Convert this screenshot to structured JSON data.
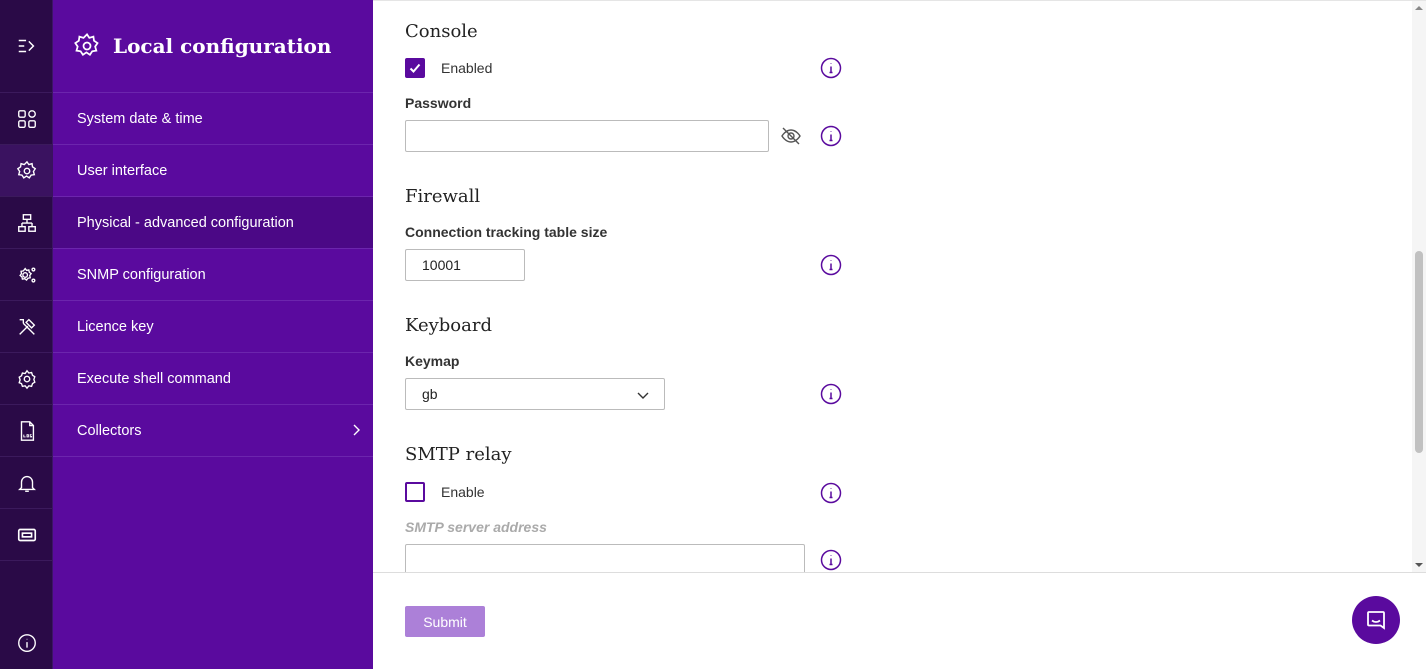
{
  "colors": {
    "accent": "#5a0a9e",
    "rail": "#2a0a47",
    "submit_disabled": "#ac80d8"
  },
  "rail": {
    "icons": [
      "menu-toggle-icon",
      "dashboard-icon",
      "config-gear-icon",
      "network-icon",
      "snmp-gear-icon",
      "tools-icon",
      "settings-icon",
      "log-file-icon",
      "bell-icon",
      "ticket-icon",
      "info-icon"
    ]
  },
  "menu": {
    "title": "Local configuration",
    "items": [
      {
        "label": "System date & time"
      },
      {
        "label": "User interface"
      },
      {
        "label": "Physical - advanced configuration"
      },
      {
        "label": "SNMP configuration"
      },
      {
        "label": "Licence key"
      },
      {
        "label": "Execute shell command"
      },
      {
        "label": "Collectors"
      }
    ]
  },
  "console": {
    "title": "Console",
    "enabled_label": "Enabled",
    "enabled_checked": true,
    "password_label": "Password",
    "password_value": ""
  },
  "firewall": {
    "title": "Firewall",
    "table_size_label": "Connection tracking table size",
    "table_size_value": "10001"
  },
  "keyboard": {
    "title": "Keyboard",
    "keymap_label": "Keymap",
    "keymap_value": "gb"
  },
  "smtp": {
    "title": "SMTP relay",
    "enable_label": "Enable",
    "enable_checked": false,
    "server_label": "SMTP server address",
    "server_value": ""
  },
  "footer": {
    "submit_label": "Submit"
  }
}
